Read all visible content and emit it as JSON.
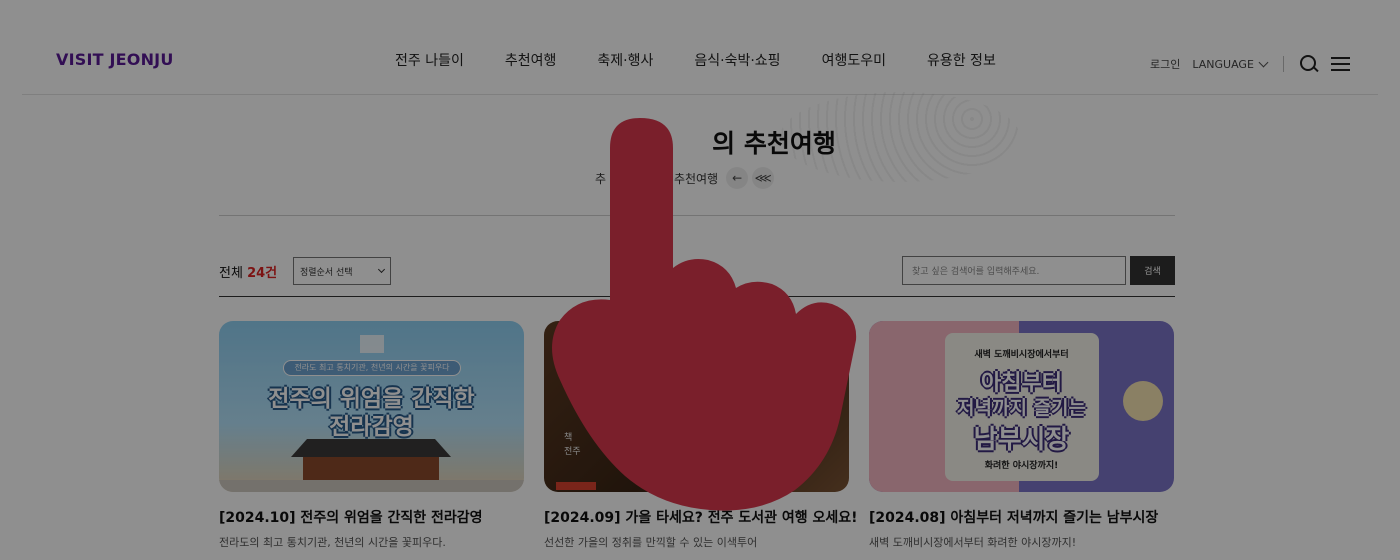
{
  "header": {
    "logo": "VISIT JEONJU",
    "nav": [
      "전주 나들이",
      "추천여행",
      "축제·행사",
      "음식·숙박·쇼핑",
      "여행도우미",
      "유용한 정보"
    ],
    "login": "로그인",
    "language": "LANGUAGE"
  },
  "page": {
    "title": "의 추천여행",
    "breadcrumb_a": "추",
    "breadcrumb_b": "달의 추천여행",
    "back_glyph": "←",
    "share_glyph": "⋘"
  },
  "list": {
    "count_label": "전체",
    "count_value": "24건",
    "sort_placeholder": "정렬순서 선택",
    "search_placeholder": "찾고 싶은 검색어를 입력해주세요.",
    "search_button": "검색"
  },
  "cards": [
    {
      "title": "[2024.10] 전주의 위엄을 간직한 전라감영",
      "desc": "전라도의 최고 통치기관, 천년의 시간을 꽃피우다.",
      "thumb_sub": "전라도 최고 통치기관, 천년의 시간을 꽃피우다",
      "thumb_line1": "전주의 위엄을 간직한",
      "thumb_line2": "전라감영"
    },
    {
      "title": "[2024.09] 가을 타세요? 전주 도서관 여행 오세요!",
      "desc": "선선한 가을의 정취를 만끽할 수 있는 이색투어",
      "thumb_sign_line1": "책",
      "thumb_sign_line2": "전주"
    },
    {
      "title": "[2024.08] 아침부터 저녁까지 즐기는 남부시장",
      "desc": "새벽 도깨비시장에서부터 화려한 야시장까지!",
      "thumb_top": "새벽 도깨비시장에서부터",
      "thumb_line1": "아침부터",
      "thumb_line2": "저녁까지 즐기는",
      "thumb_line3": "남부시장",
      "thumb_bottom": "화려한 야시장까지!"
    }
  ],
  "colors": {
    "logo": "#5a1a96",
    "count": "#dd2222",
    "overlay": "rgba(0,0,0,0.44)",
    "pointer": "#7a1f2b"
  }
}
